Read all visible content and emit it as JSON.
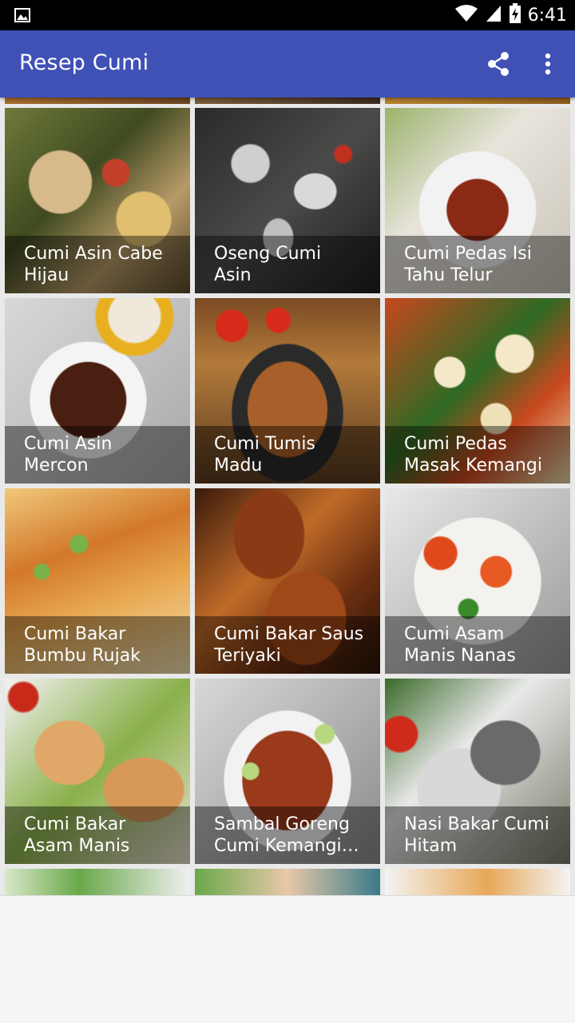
{
  "status_bar": {
    "time": "6:41",
    "icons": [
      "image-notification-icon",
      "wifi-icon",
      "cell-signal-icon",
      "battery-charging-icon"
    ]
  },
  "app_bar": {
    "title": "Resep Cumi",
    "actions": [
      "share-icon",
      "more-vert-icon"
    ],
    "color": "#3f51b5"
  },
  "recipes": [
    {
      "title": "Cumi Asin Cabe\nHijau"
    },
    {
      "title": "Oseng Cumi\nAsin"
    },
    {
      "title": "Cumi Pedas Isi\nTahu Telur"
    },
    {
      "title": "Cumi Asin\nMercon"
    },
    {
      "title": "Cumi Tumis\nMadu"
    },
    {
      "title": "Cumi Pedas\nMasak Kemangi"
    },
    {
      "title": "Cumi Bakar\nBumbu Rujak"
    },
    {
      "title": "Cumi Bakar Saus\nTeriyaki"
    },
    {
      "title": "Cumi Asam\nManis Nanas"
    },
    {
      "title": "Cumi Bakar\nAsam Manis"
    },
    {
      "title": "Sambal Goreng\nCumi Kemangi…"
    },
    {
      "title": "Nasi Bakar Cumi\nHitam"
    }
  ]
}
